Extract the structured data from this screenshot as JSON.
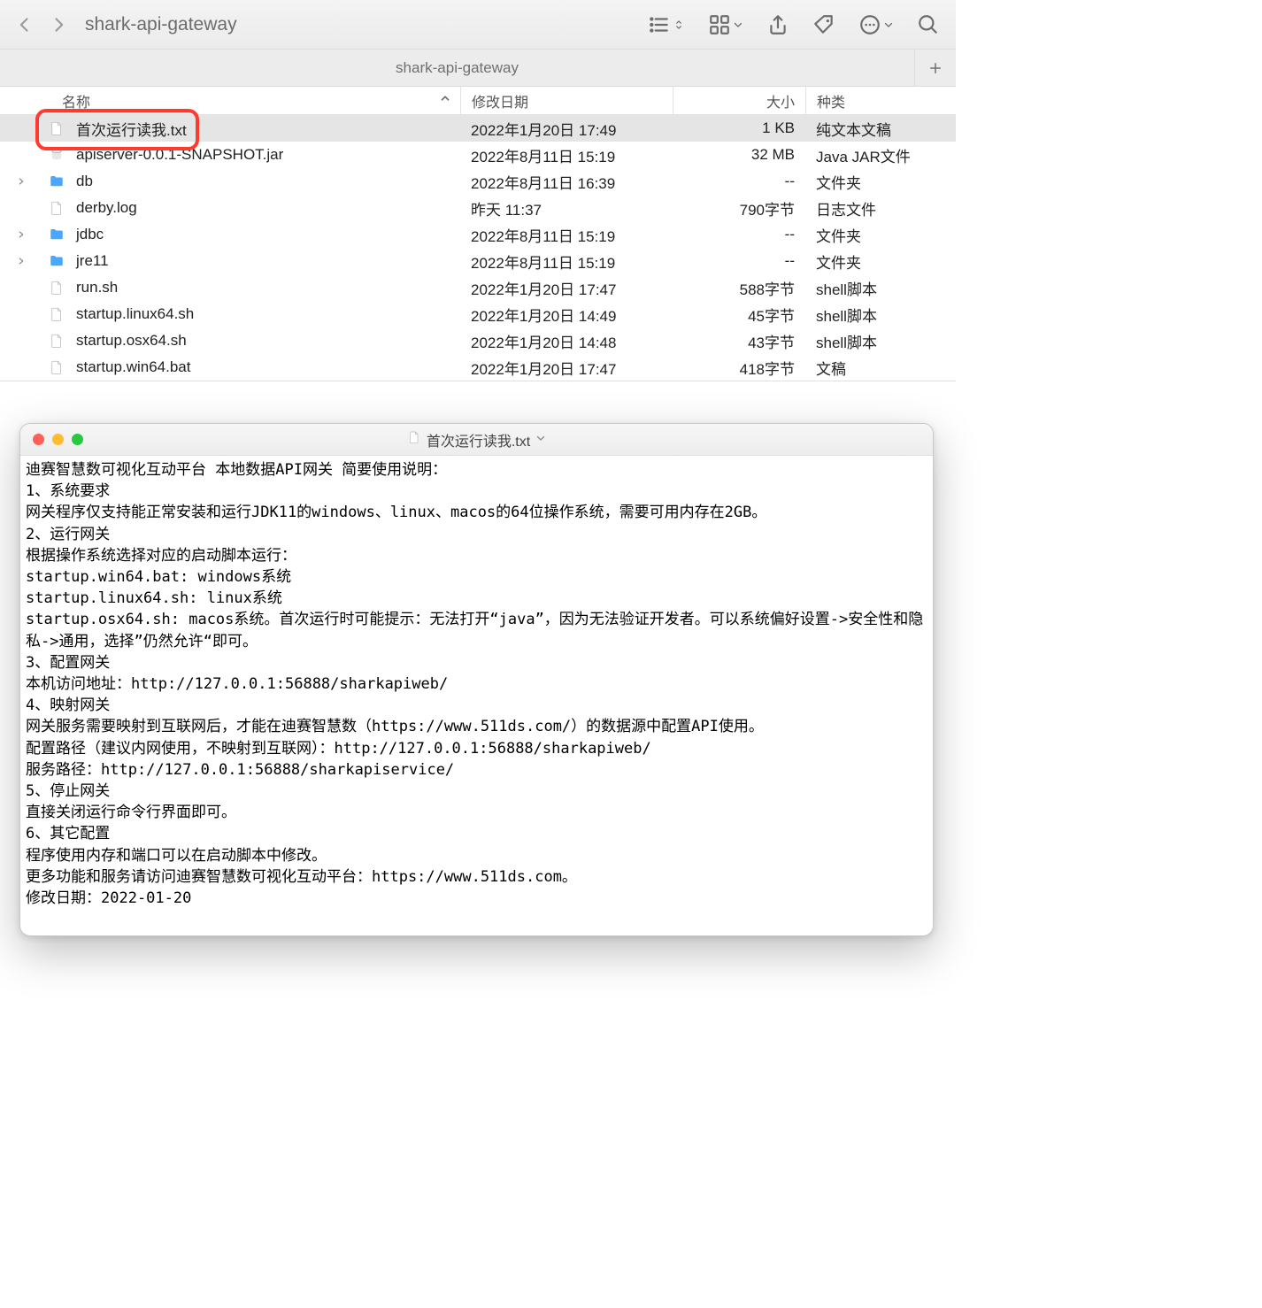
{
  "finder": {
    "nav_title": "shark-api-gateway",
    "tab_title": "shark-api-gateway",
    "columns": {
      "name": "名称",
      "date": "修改日期",
      "size": "大小",
      "kind": "种类"
    },
    "rows": [
      {
        "selected": true,
        "expandable": false,
        "icon": "txt",
        "name": "首次运行读我.txt",
        "date": "2022年1月20日 17:49",
        "size": "1 KB",
        "kind": "纯文本文稿"
      },
      {
        "selected": false,
        "expandable": false,
        "icon": "jar",
        "name": "apiserver-0.0.1-SNAPSHOT.jar",
        "date": "2022年8月11日 15:19",
        "size": "32 MB",
        "kind": "Java JAR文件"
      },
      {
        "selected": false,
        "expandable": true,
        "icon": "folder",
        "name": "db",
        "date": "2022年8月11日 16:39",
        "size": "--",
        "kind": "文件夹"
      },
      {
        "selected": false,
        "expandable": false,
        "icon": "log",
        "name": "derby.log",
        "date": "昨天 11:37",
        "size": "790字节",
        "kind": "日志文件"
      },
      {
        "selected": false,
        "expandable": true,
        "icon": "folder",
        "name": "jdbc",
        "date": "2022年8月11日 15:19",
        "size": "--",
        "kind": "文件夹"
      },
      {
        "selected": false,
        "expandable": true,
        "icon": "folder",
        "name": "jre11",
        "date": "2022年8月11日 15:19",
        "size": "--",
        "kind": "文件夹"
      },
      {
        "selected": false,
        "expandable": false,
        "icon": "shell",
        "name": "run.sh",
        "date": "2022年1月20日 17:47",
        "size": "588字节",
        "kind": "shell脚本"
      },
      {
        "selected": false,
        "expandable": false,
        "icon": "shell",
        "name": "startup.linux64.sh",
        "date": "2022年1月20日 14:49",
        "size": "45字节",
        "kind": "shell脚本"
      },
      {
        "selected": false,
        "expandable": false,
        "icon": "shell",
        "name": "startup.osx64.sh",
        "date": "2022年1月20日 14:48",
        "size": "43字节",
        "kind": "shell脚本"
      },
      {
        "selected": false,
        "expandable": false,
        "icon": "bat",
        "name": "startup.win64.bat",
        "date": "2022年1月20日 17:47",
        "size": "418字节",
        "kind": "文稿"
      }
    ],
    "highlight_index": 0
  },
  "textedit": {
    "title": "首次运行读我.txt",
    "body": "迪赛智慧数可视化互动平台 本地数据API网关 简要使用说明：\n1、系统要求\n网关程序仅支持能正常安装和运行JDK11的windows、linux、macos的64位操作系统，需要可用内存在2GB。\n2、运行网关\n根据操作系统选择对应的启动脚本运行：\nstartup.win64.bat: windows系统\nstartup.linux64.sh: linux系统\nstartup.osx64.sh: macos系统。首次运行时可能提示：无法打开“java”，因为无法验证开发者。可以系统偏好设置->安全性和隐私->通用，选择”仍然允许“即可。\n3、配置网关\n本机访问地址：http://127.0.0.1:56888/sharkapiweb/\n4、映射网关\n网关服务需要映射到互联网后，才能在迪赛智慧数（https://www.511ds.com/）的数据源中配置API使用。\n配置路径（建议内网使用，不映射到互联网）：http://127.0.0.1:56888/sharkapiweb/\n服务路径：http://127.0.0.1:56888/sharkapiservice/\n5、停止网关\n直接关闭运行命令行界面即可。\n6、其它配置\n程序使用内存和端口可以在启动脚本中修改。\n更多功能和服务请访问迪赛智慧数可视化互动平台：https://www.511ds.com。\n修改日期：2022-01-20"
  }
}
